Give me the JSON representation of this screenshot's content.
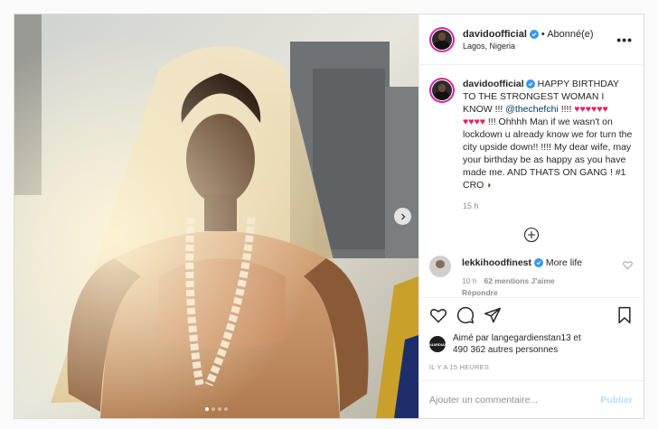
{
  "post": {
    "author": "davidoofficial",
    "follow_state": "• Abonné(e)",
    "location": "Lagos, Nigeria",
    "more_icon": "more-horizontal-icon"
  },
  "caption": {
    "username": "davidoofficial",
    "text_1": " HAPPY BIRTHDAY TO THE STRONGEST WOMAN I KNOW !!! ",
    "mention": "@thechefchi",
    "text_2": " !!!! ",
    "hearts_1": "♥♥♥♥♥♥",
    "hearts_2": "♥♥♥♥",
    "text_3": " !!! Ohhhh Man if we wasn't on lockdown u already know we for turn the city upside down!! !!!! My dear wife, may your birthday be as happy as you have made me. AND THATS ON GANG ! #1 CRO ",
    "time": "15 h"
  },
  "comments": [
    {
      "username": "lekkihoodfinest",
      "text": "More life",
      "time": "10 h",
      "likes": "62 mentions J'aime",
      "reply": "Répondre"
    }
  ],
  "likes": {
    "prefix": "Aimé par ",
    "user": "langegardienstan13",
    "suffix": " et",
    "count": "490 362 autres personnes",
    "avatar_label": "GUARDIAN"
  },
  "timestamp": "IL Y A 15 HEURES",
  "composer": {
    "placeholder": "Ajouter un commentaire...",
    "publish_label": "Publier"
  },
  "carousel": {
    "slides": 4,
    "active": 0
  },
  "colors": {
    "verified": "#3897f0",
    "heart": "#e0245e",
    "publish": "#b2dffc",
    "mention": "#00376b"
  }
}
